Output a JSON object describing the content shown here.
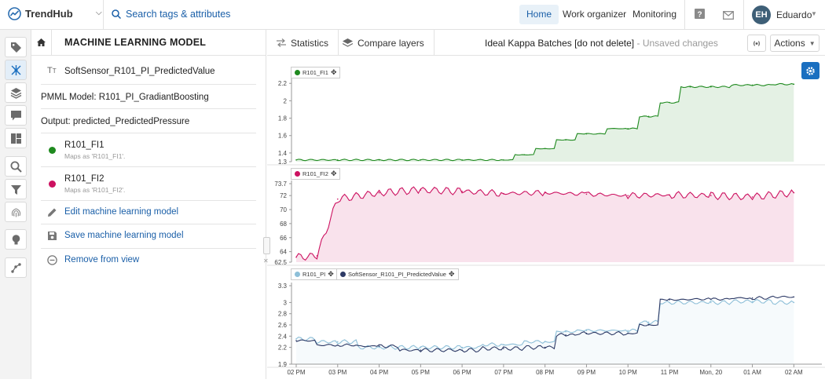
{
  "app": {
    "logo_text": "TrendHub",
    "search_label": "Search tags & attributes",
    "nav": [
      "Home",
      "Work organizer",
      "Monitoring"
    ],
    "user_initials": "EH",
    "user_name": "Eduardo"
  },
  "panel": {
    "title": "MACHINE LEARNING MODEL",
    "output_tag": "SoftSensor_R101_PI_PredictedValue",
    "pmml_model": "PMML Model: R101_PI_GradiantBoosting",
    "output": "Output: predicted_PredictedPressure",
    "signals": [
      {
        "name": "R101_FI1",
        "mapping": "Maps as 'R101_FI1'.",
        "color": "#1f8a1f"
      },
      {
        "name": "R101_FI2",
        "mapping": "Maps as 'R101_FI2'.",
        "color": "#cc1160"
      }
    ],
    "actions": [
      "Edit machine learning model",
      "Save machine learning model",
      "Remove from view"
    ]
  },
  "toolbar": {
    "statistics": "Statistics",
    "compare_layers": "Compare layers",
    "worksheet_title": "Ideal Kappa Batches [do not delete]",
    "unsaved": "- Unsaved changes",
    "actions": "Actions"
  },
  "chart_data": [
    {
      "type": "line",
      "series": [
        {
          "name": "R101_FI1",
          "color": "#1f8a1f",
          "x": [
            "02 PM",
            "03 PM",
            "04 PM",
            "05 PM",
            "06 PM",
            "07 PM",
            "07:30 PM",
            "08 PM",
            "08:30 PM",
            "09 PM",
            "10 PM",
            "10:30 PM",
            "11 PM",
            "11:30 PM",
            "Mon, 20",
            "01 AM",
            "02 AM"
          ],
          "values": [
            1.32,
            1.32,
            1.32,
            1.32,
            1.32,
            1.32,
            1.38,
            1.45,
            1.55,
            1.62,
            1.68,
            1.82,
            1.98,
            2.16,
            2.16,
            2.18,
            2.19
          ]
        }
      ],
      "yticks": [
        1.3,
        1.4,
        1.6,
        1.8,
        2,
        2.2
      ],
      "ylim": [
        1.3,
        2.22
      ]
    },
    {
      "type": "line",
      "series": [
        {
          "name": "R101_FI2",
          "color": "#cc1160",
          "x": [
            "02 PM",
            "02:30 PM",
            "03 PM",
            "04 PM",
            "05 PM",
            "06 PM",
            "07 PM",
            "08 PM",
            "09 PM",
            "10 PM",
            "11 PM",
            "Mon, 20",
            "01 AM",
            "02 AM"
          ],
          "values": [
            63.2,
            63.4,
            71.5,
            72.4,
            72.8,
            72.6,
            72.3,
            72.4,
            72.2,
            72.0,
            72.1,
            72.0,
            71.8,
            72.4
          ]
        }
      ],
      "yticks": [
        62.5,
        64,
        66,
        68,
        70,
        72,
        73.7
      ],
      "ylim": [
        62.5,
        73.7
      ]
    },
    {
      "type": "line",
      "x_ticks": [
        "02 PM",
        "03 PM",
        "04 PM",
        "05 PM",
        "06 PM",
        "07 PM",
        "08 PM",
        "09 PM",
        "10 PM",
        "11 PM",
        "Mon, 20",
        "01 AM",
        "02 AM"
      ],
      "series": [
        {
          "name": "R101_PI",
          "color": "#8dbfd8",
          "x": [
            "02 PM",
            "03 PM",
            "04 PM",
            "05 PM",
            "06 PM",
            "07 PM",
            "08 PM",
            "08:30 PM",
            "09 PM",
            "10 PM",
            "10:30 PM",
            "11 PM",
            "Mon, 20",
            "01 AM",
            "02 AM"
          ],
          "values": [
            2.35,
            2.3,
            2.2,
            2.2,
            2.2,
            2.25,
            2.3,
            2.48,
            2.5,
            2.5,
            2.65,
            3.0,
            3.0,
            3.02,
            3.0
          ]
        },
        {
          "name": "SoftSensor_R101_PI_PredictedValue",
          "color": "#2d3a66",
          "x": [
            "02 PM",
            "03 PM",
            "04 PM",
            "05 PM",
            "06 PM",
            "07 PM",
            "08 PM",
            "08:30 PM",
            "09 PM",
            "10 PM",
            "10:30 PM",
            "11 PM",
            "Mon, 20",
            "01 AM",
            "02 AM"
          ],
          "values": [
            2.32,
            2.24,
            2.22,
            2.15,
            2.15,
            2.18,
            2.2,
            2.42,
            2.45,
            2.45,
            2.6,
            3.05,
            3.06,
            3.08,
            3.1
          ]
        }
      ],
      "yticks": [
        1.9,
        2.2,
        2.4,
        2.6,
        2.8,
        3,
        3.3
      ],
      "ylim": [
        1.9,
        3.3
      ]
    }
  ]
}
